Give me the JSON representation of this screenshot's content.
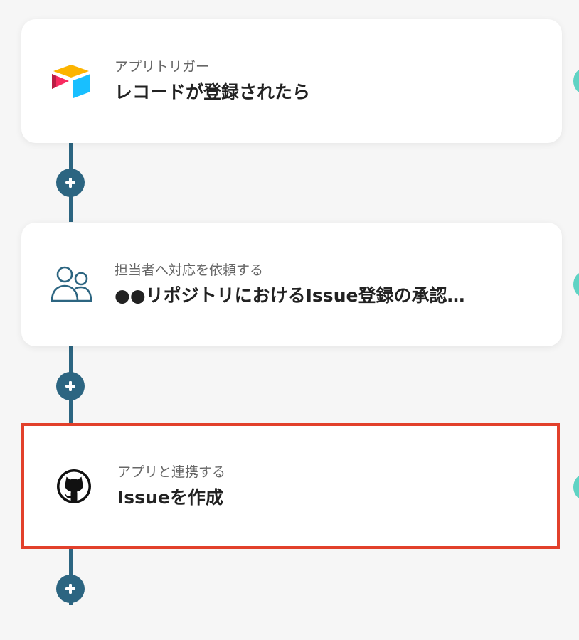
{
  "flow": {
    "steps": [
      {
        "kind": "アプリトリガー",
        "title": "レコードが登録されたら",
        "icon": "airtable-icon"
      },
      {
        "kind": "担当者へ対応を依頼する",
        "title": "●●リポジトリにおけるIssue登録の承認…",
        "icon": "users-icon"
      },
      {
        "kind": "アプリと連携する",
        "title": "Issueを作成",
        "icon": "github-icon"
      }
    ]
  },
  "colors": {
    "connector": "#2c6581",
    "selected_border": "#e2402b",
    "status": "#5fd3c4",
    "background": "#f6f6f6"
  }
}
